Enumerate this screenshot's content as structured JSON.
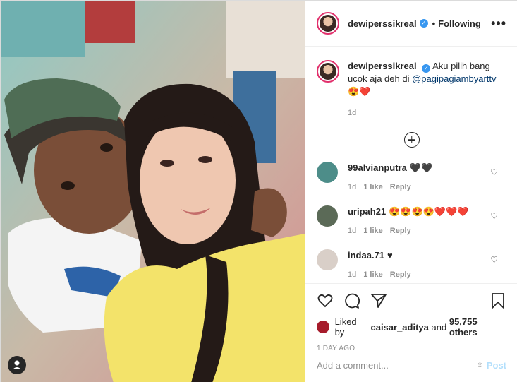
{
  "post": {
    "username": "dewiperssikreal",
    "following_label": "Following",
    "separator": "•",
    "more_label": "•••"
  },
  "caption": {
    "username": "dewiperssikreal",
    "text": "Aku pilih bang ucok aja deh di",
    "mention": "@pagipagiambyarttv",
    "emojis": "😍❤️",
    "age": "1d"
  },
  "comments": [
    {
      "username": "99alvianputra",
      "text": "🖤🖤",
      "age": "1d",
      "likes": "1 like",
      "reply": "Reply"
    },
    {
      "username": "uripah21",
      "text": "😍😍😍😍❤️❤️❤️",
      "age": "1d",
      "likes": "1 like",
      "reply": "Reply"
    },
    {
      "username": "indaa.71",
      "text": "♥",
      "age": "1d",
      "likes": "1 like",
      "reply": "Reply"
    }
  ],
  "likes": {
    "prefix": "Liked by",
    "user": "caisar_aditya",
    "middle": "and",
    "count": "95,755 others"
  },
  "timestamp": "1 DAY AGO",
  "add_comment": {
    "placeholder": "Add a comment...",
    "post_label": "Post"
  },
  "icons": {
    "verified": "verified-badge-icon",
    "more": "more-options-icon",
    "load_more": "plus-circle-icon",
    "like": "heart-icon",
    "comment": "comment-bubble-icon",
    "share": "paper-plane-icon",
    "save": "bookmark-icon",
    "emoji": "emoji-icon"
  },
  "colors": {
    "accent": "#3897f0",
    "mention": "#00376b",
    "muted": "#8e8e8e",
    "post_disabled": "#b2dffc"
  }
}
